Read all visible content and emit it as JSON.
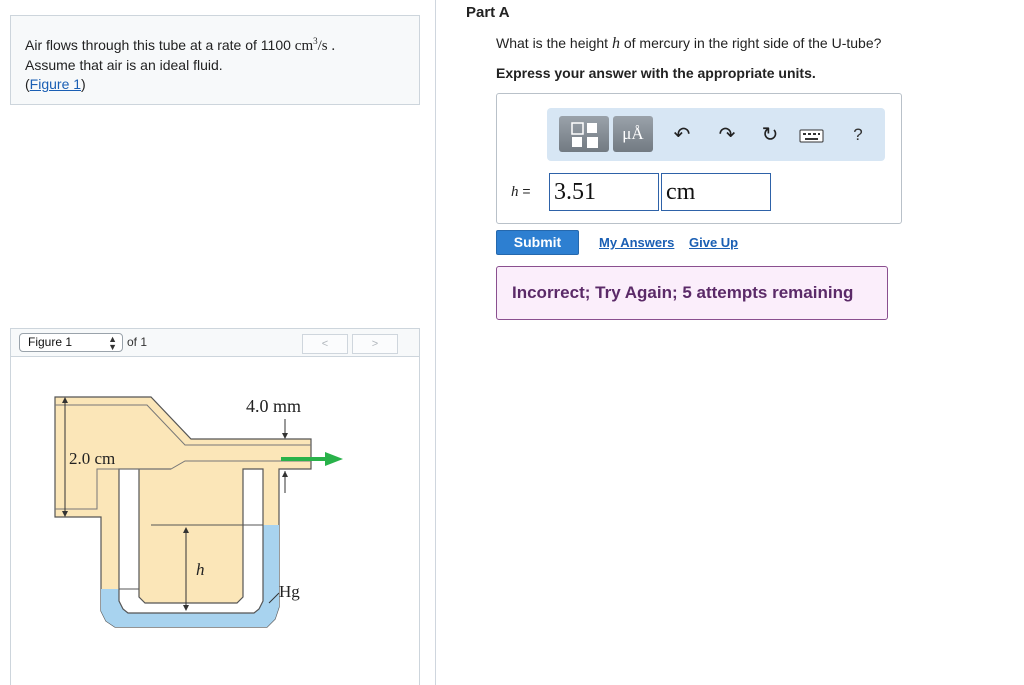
{
  "problem": {
    "text_before": "Air flows through this tube at a rate of 1100 ",
    "unit_base": "cm",
    "unit_exp": "3",
    "unit_rest": "/s .",
    "line2": "Assume that air is an ideal fluid.",
    "link_open": "(",
    "figure_link": "Figure 1",
    "link_close": ")"
  },
  "figure_nav": {
    "selected": "Figure 1",
    "of_text": "of 1",
    "prev_label": "<",
    "next_label": ">"
  },
  "figure": {
    "label_width": "4.0 mm",
    "label_height": "2.0 cm",
    "label_h": "h",
    "label_hg": "Hg",
    "colors": {
      "air": "#fbe6b8",
      "mercury": "#a8d3ef",
      "arrow": "#29b24a"
    }
  },
  "part": {
    "title": "Part A",
    "question_before": "What is the height ",
    "question_var": "h",
    "question_after": " of mercury in the right side of the U-tube?",
    "instruction": "Express your answer with the appropriate units."
  },
  "toolbar": {
    "units_label": "μÅ",
    "undo_icon": "undo-arrow-icon",
    "redo_icon": "redo-arrow-icon",
    "reset_icon": "reset-icon",
    "keyboard_icon": "keyboard-icon",
    "help_label": "?"
  },
  "answer": {
    "var_label": "h",
    "equals": " =",
    "value": "3.51",
    "units": "cm"
  },
  "actions": {
    "submit": "Submit",
    "my_answers": "My Answers",
    "give_up": "Give Up"
  },
  "feedback": {
    "message": "Incorrect; Try Again; 5 attempts remaining",
    "colors": {
      "border": "#8a4f8f",
      "background": "#fbeefb",
      "text": "#5b2a68"
    }
  }
}
